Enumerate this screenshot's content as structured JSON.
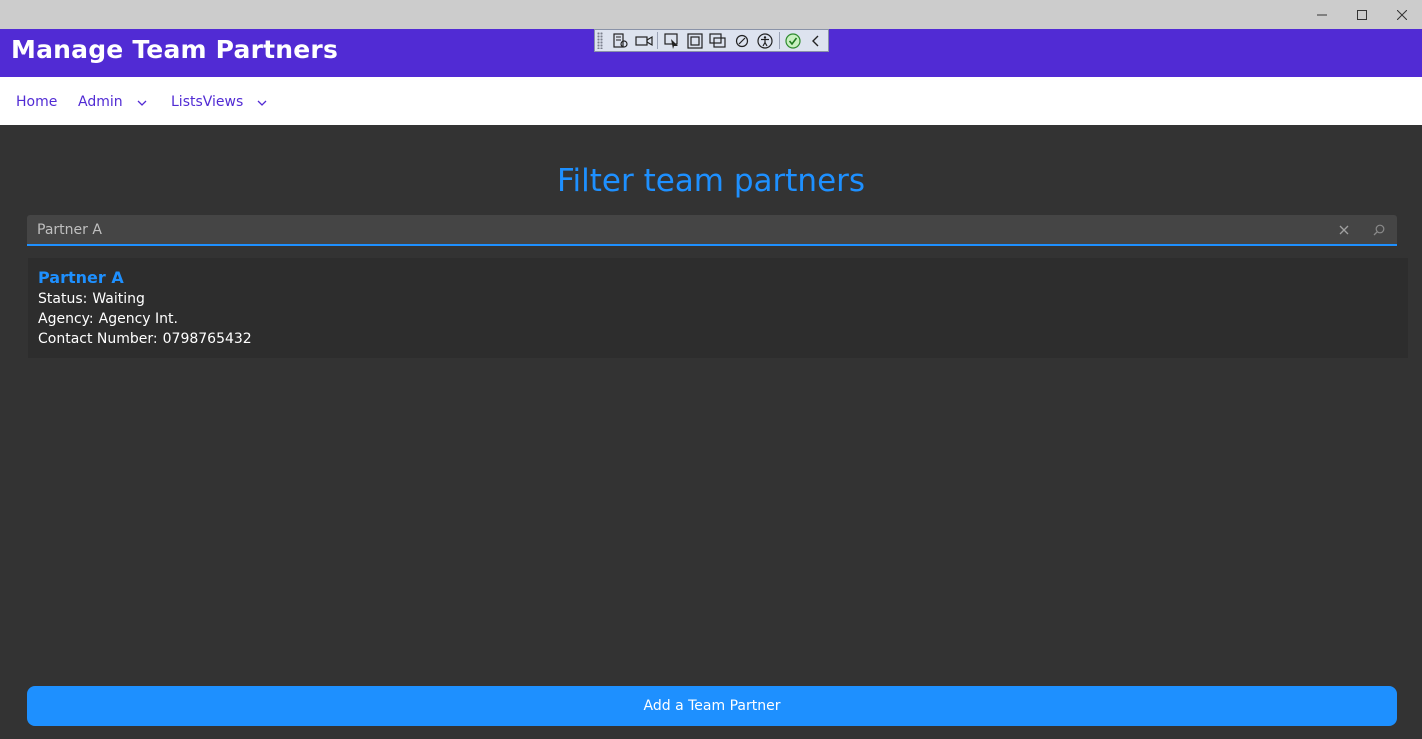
{
  "window": {
    "controls": [
      "minimize-icon",
      "maximize-icon",
      "close-icon"
    ]
  },
  "app": {
    "title": "Manage Team Partners",
    "brand_color": "#512BD4"
  },
  "debug_toolbar": {
    "icons": [
      "live-visual-tree-icon",
      "record-icon",
      "select-element-icon",
      "display-layout-adorners-icon",
      "track-focus-icon",
      "binding-failures-icon",
      "accessibility-icon",
      "checkmark-icon",
      "collapse-chevron-icon"
    ]
  },
  "nav": {
    "items": [
      {
        "label": "Home",
        "has_dropdown": false
      },
      {
        "label": "Admin",
        "has_dropdown": true
      },
      {
        "label": "ListsViews",
        "has_dropdown": true
      }
    ]
  },
  "main": {
    "heading": "Filter team partners",
    "search": {
      "value": "Partner A",
      "placeholder": "",
      "clear_icon": "close-icon",
      "search_icon": "search-icon"
    },
    "results": [
      {
        "name": "Partner A",
        "status_label": "Status:",
        "status": "Waiting",
        "agency_label": "Agency:",
        "agency": "Agency Int.",
        "contact_label": "Contact Number:",
        "contact": "0798765432"
      }
    ],
    "add_button_label": "Add a Team Partner",
    "accent_color": "#1E90FF"
  }
}
